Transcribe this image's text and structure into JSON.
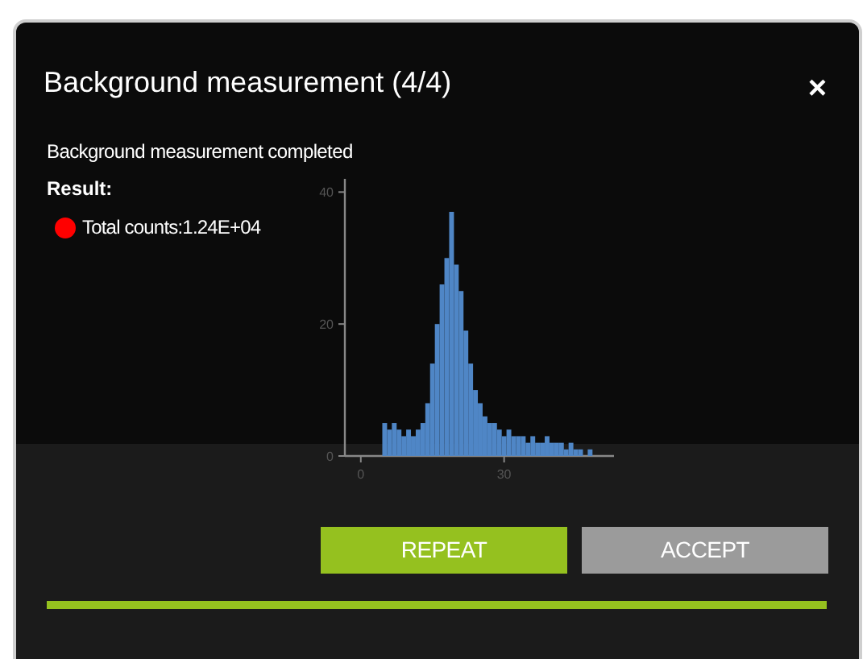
{
  "dialog": {
    "title": "Background measurement (4/4)",
    "close": "×"
  },
  "status": "Background measurement completed",
  "result_label": "Result:",
  "results": [
    {
      "label": "Total counts:1.24E+04",
      "color": "#ff0000"
    }
  ],
  "chart_data": {
    "type": "bar",
    "x": [
      5,
      6,
      7,
      8,
      9,
      10,
      11,
      12,
      13,
      14,
      15,
      16,
      17,
      18,
      19,
      20,
      21,
      22,
      23,
      24,
      25,
      26,
      27,
      28,
      29,
      30,
      31,
      32,
      33,
      34,
      35,
      36,
      37,
      38,
      39,
      40,
      41,
      42,
      43,
      44,
      45,
      46,
      47,
      48
    ],
    "values": [
      5,
      4,
      5,
      4,
      3,
      4,
      3,
      4,
      5,
      8,
      14,
      20,
      26,
      30,
      37,
      29,
      25,
      19,
      14,
      10,
      8,
      6,
      5,
      5,
      4,
      3,
      4,
      3,
      3,
      3,
      2,
      3,
      2,
      2,
      3,
      2,
      2,
      2,
      1,
      2,
      1,
      1,
      0,
      1
    ],
    "xlim": [
      -3,
      53
    ],
    "ylim": [
      0,
      42
    ],
    "xticks": [
      0,
      30
    ],
    "yticks": [
      0,
      20,
      40
    ]
  },
  "buttons": [
    {
      "label": "REPEAT",
      "kind": "primary"
    },
    {
      "label": "ACCEPT",
      "kind": "secondary"
    }
  ]
}
